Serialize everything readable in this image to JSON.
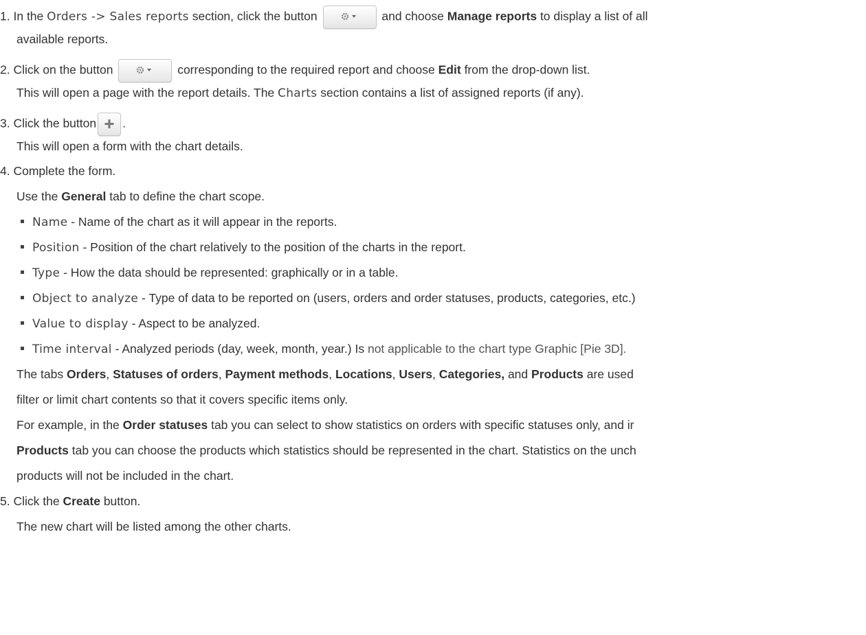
{
  "steps": {
    "s1": {
      "num": "1.",
      "a": "In the",
      "path": "Orders -> Sales reports",
      "b": "section, click the button",
      "c": "and choose",
      "bold": "Manage reports",
      "d": "to display a list of all",
      "cont": "available reports."
    },
    "s2": {
      "num": "2.",
      "a": "Click on the button",
      "b": "corresponding to the required report and choose",
      "bold": "Edit",
      "c": "from the drop-down list.",
      "sub_a": "This will open a page with the report details. The",
      "sub_code": "Charts",
      "sub_b": "section contains a list of assigned reports (if any)."
    },
    "s3": {
      "num": "3.",
      "a": "Click the button",
      "b": ".",
      "sub": "This will open a form with the chart details."
    },
    "s4": {
      "num": "4.",
      "text": "Complete the form.",
      "use_a": "Use the",
      "use_bold": "General",
      "use_b": "tab to define the chart scope.",
      "fields": [
        {
          "name": "Name",
          "desc": " - Name of the chart as it will appear in the reports."
        },
        {
          "name": "Position",
          "desc": " - Position of the chart relatively to the position of the charts in the report."
        },
        {
          "name": "Type",
          "desc": " - How the data should be represented: graphically or in a table."
        },
        {
          "name": "Object to analyze",
          "desc": " - Type of data to be reported on (users, orders and order statuses, products, categories, etc.)"
        },
        {
          "name": "Value to display",
          "desc": " - Aspect to be analyzed."
        },
        {
          "name": "Time interval",
          "desc": " - Analyzed periods (day, week, month, year.) Is",
          "desc2": " not applicable to the chart type Graphic [Pie 3D]."
        }
      ],
      "tabs": {
        "a": "The tabs",
        "t1": "Orders",
        "t2": "Statuses of orders",
        "t3": "Payment methods",
        "t4": "Locations",
        "t5": "Users",
        "t6": "Categories,",
        "and": "and",
        "t7": "Products",
        "b": "are used",
        "cont": "filter or limit chart contents so that it covers specific items only."
      },
      "example": {
        "a": "For example, in the",
        "bold1": "Order statuses",
        "b": "tab you can select to show statistics on orders with specific statuses only, and ir",
        "bold2": "Products",
        "c": "tab you can choose the products which statistics should be represented in the chart. Statistics on the unch",
        "d": "products will not be included in the chart."
      }
    },
    "s5": {
      "num": "5.",
      "a": "Click the",
      "bold": "Create",
      "b": "button.",
      "sub": "The new chart will be listed among the other charts."
    }
  },
  "icons": {
    "gear": "gear-caret-icon",
    "plus": "plus-icon"
  }
}
